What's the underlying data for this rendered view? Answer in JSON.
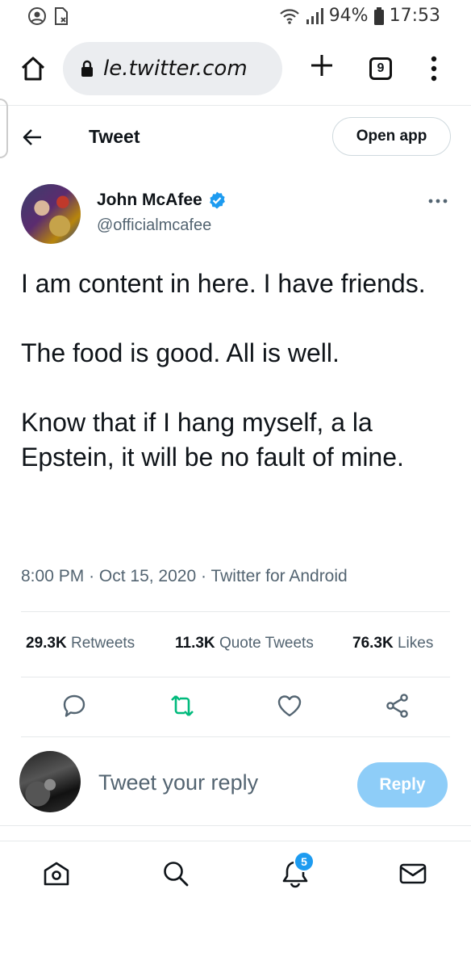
{
  "status_bar": {
    "battery": "94%",
    "time": "17:53",
    "icons": [
      "account-circle-icon",
      "sim-card-icon",
      "wifi-icon",
      "signal-icon",
      "battery-icon"
    ]
  },
  "browser": {
    "url": "le.twitter.com",
    "tab_count": "9",
    "icons": [
      "home-icon",
      "lock-icon",
      "plus-icon",
      "tabs-icon",
      "more-vertical-icon"
    ]
  },
  "header": {
    "title": "Tweet",
    "open_app_label": "Open app"
  },
  "author": {
    "name": "John McAfee",
    "handle": "@officialmcafee",
    "verified": true
  },
  "tweet": {
    "paragraphs": [
      "I am content in here. I have friends.",
      "The food is good. All is well.",
      "Know that if I hang myself, a la Epstein, it will be no fault of mine."
    ],
    "time": "8:00 PM",
    "date": "Oct 15, 2020",
    "source": "Twitter for Android",
    "separator": "·"
  },
  "stats": {
    "retweets_count": "29.3K",
    "retweets_label": "Retweets",
    "quotes_count": "11.3K",
    "quotes_label": "Quote Tweets",
    "likes_count": "76.3K",
    "likes_label": "Likes"
  },
  "actions": [
    "reply-icon",
    "retweet-icon",
    "like-icon",
    "share-icon"
  ],
  "reply": {
    "placeholder": "Tweet your reply",
    "button_label": "Reply"
  },
  "bottom_nav": {
    "items": [
      "home-icon",
      "search-icon",
      "notifications-icon",
      "messages-icon"
    ],
    "notifications_badge": "5"
  },
  "colors": {
    "accent": "#1d9bf0",
    "retweet_green": "#00ba7c",
    "reply_button_disabled": "#8ecdf8",
    "secondary_text": "#536471"
  }
}
